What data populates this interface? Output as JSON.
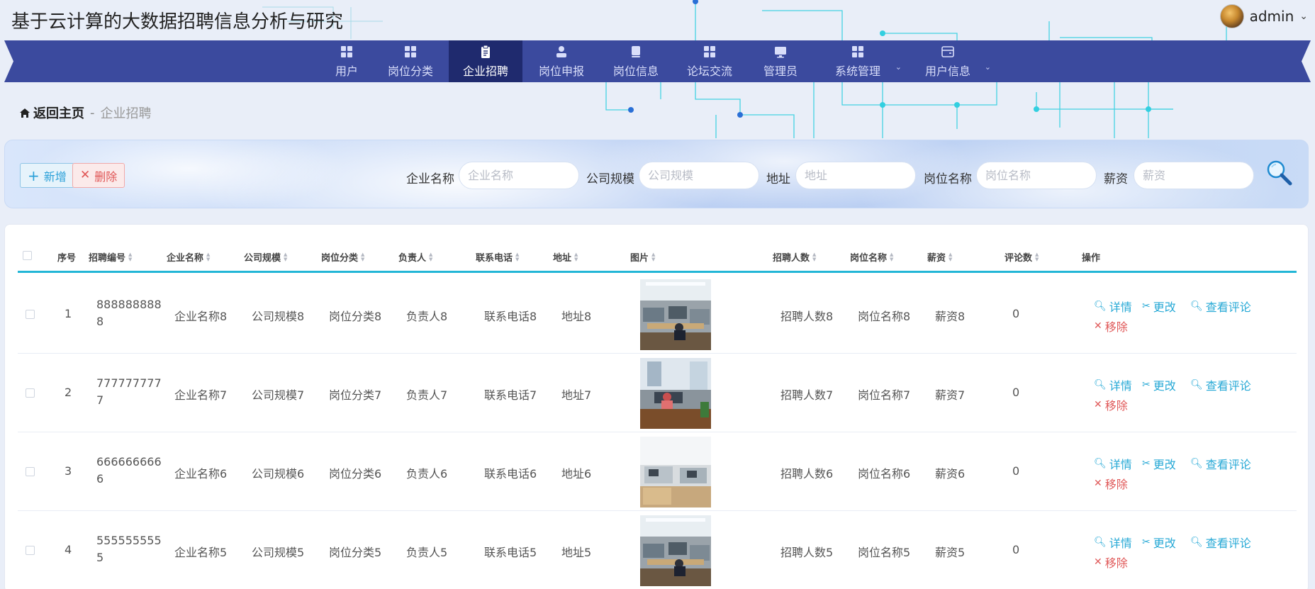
{
  "app": {
    "title": "基于云计算的大数据招聘信息分析与研究"
  },
  "user": {
    "name": "admin",
    "caret": "⌄"
  },
  "nav": {
    "items": [
      {
        "label": "用户"
      },
      {
        "label": "岗位分类"
      },
      {
        "label": "企业招聘",
        "active": true
      },
      {
        "label": "岗位申报"
      },
      {
        "label": "岗位信息"
      },
      {
        "label": "论坛交流"
      },
      {
        "label": "管理员"
      },
      {
        "label": "系统管理",
        "dropdown": true
      },
      {
        "label": "用户信息",
        "dropdown": true
      }
    ]
  },
  "breadcrumb": {
    "home": "返回主页",
    "sep": "-",
    "current": "企业招聘"
  },
  "toolbar": {
    "add_label": "新增",
    "delete_label": "删除"
  },
  "search": {
    "fields": [
      {
        "label": "企业名称",
        "placeholder": "企业名称"
      },
      {
        "label": "公司规模",
        "placeholder": "公司规模"
      },
      {
        "label": "地址",
        "placeholder": "地址"
      },
      {
        "label": "岗位名称",
        "placeholder": "岗位名称"
      },
      {
        "label": "薪资",
        "placeholder": "薪资"
      }
    ]
  },
  "table": {
    "columns": [
      "序号",
      "招聘编号",
      "企业名称",
      "公司规模",
      "岗位分类",
      "负责人",
      "联系电话",
      "地址",
      "图片",
      "招聘人数",
      "岗位名称",
      "薪资",
      "评论数",
      "操作"
    ],
    "rows": [
      {
        "index": "1",
        "code": "8888888888",
        "company": "企业名称8",
        "scale": "公司规模8",
        "category": "岗位分类8",
        "manager": "负责人8",
        "phone": "联系电话8",
        "address": "地址8",
        "headcount": "招聘人数8",
        "job": "岗位名称8",
        "salary": "薪资8",
        "comments": "0"
      },
      {
        "index": "2",
        "code": "7777777777",
        "company": "企业名称7",
        "scale": "公司规模7",
        "category": "岗位分类7",
        "manager": "负责人7",
        "phone": "联系电话7",
        "address": "地址7",
        "headcount": "招聘人数7",
        "job": "岗位名称7",
        "salary": "薪资7",
        "comments": "0"
      },
      {
        "index": "3",
        "code": "6666666666",
        "company": "企业名称6",
        "scale": "公司规模6",
        "category": "岗位分类6",
        "manager": "负责人6",
        "phone": "联系电话6",
        "address": "地址6",
        "headcount": "招聘人数6",
        "job": "岗位名称6",
        "salary": "薪资6",
        "comments": "0"
      },
      {
        "index": "4",
        "code": "5555555555",
        "company": "企业名称5",
        "scale": "公司规模5",
        "category": "岗位分类5",
        "manager": "负责人5",
        "phone": "联系电话5",
        "address": "地址5",
        "headcount": "招聘人数5",
        "job": "岗位名称5",
        "salary": "薪资5",
        "comments": "0"
      }
    ],
    "actions": {
      "detail": "详情",
      "edit": "更改",
      "comments": "查看评论",
      "remove": "移除"
    }
  },
  "colors": {
    "nav_bg": "#3b4a9e",
    "nav_active": "#1f2a6e",
    "accent": "#22b6d6",
    "danger": "#e05656",
    "circuit": "#29c7d8"
  }
}
